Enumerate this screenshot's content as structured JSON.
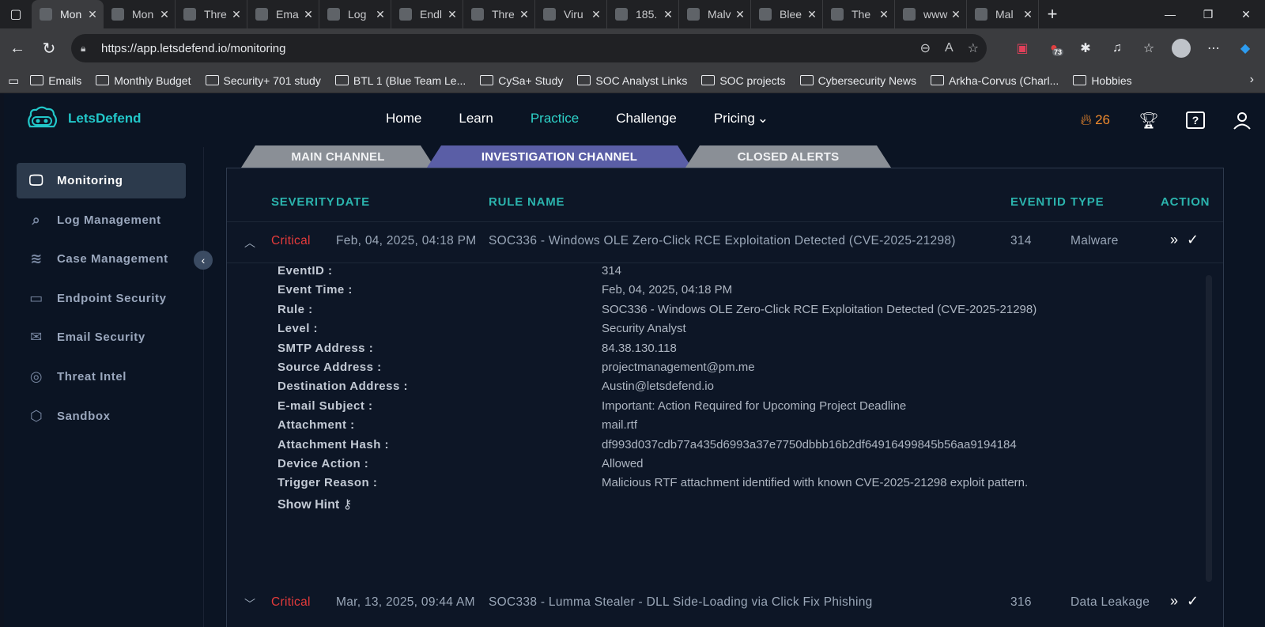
{
  "browser": {
    "tabs": [
      {
        "title": "Mon",
        "active": true
      },
      {
        "title": "Mon"
      },
      {
        "title": "Thre"
      },
      {
        "title": "Ema"
      },
      {
        "title": "Log"
      },
      {
        "title": "Endl"
      },
      {
        "title": "Thre"
      },
      {
        "title": "Viru"
      },
      {
        "title": "185."
      },
      {
        "title": "Malv"
      },
      {
        "title": "Blee"
      },
      {
        "title": "The"
      },
      {
        "title": "www"
      },
      {
        "title": "Mal"
      }
    ],
    "url": "https://app.letsdefend.io/monitoring",
    "extension_badge": "73",
    "bookmarks": [
      "Emails",
      "Monthly Budget",
      "Security+ 701 study",
      "BTL 1 (Blue Team Le...",
      "CySa+ Study",
      "SOC Analyst Links",
      "SOC projects",
      "Cybersecurity News",
      "Arkha-Corvus (Charl...",
      "Hobbies"
    ]
  },
  "app": {
    "brand": "LetsDefend",
    "menu": [
      "Home",
      "Learn",
      "Practice",
      "Challenge",
      "Pricing"
    ],
    "active_menu": "Practice",
    "streak": "26",
    "sidebar": [
      {
        "label": "Monitoring",
        "icon": "monitor-icon",
        "active": true
      },
      {
        "label": "Log Management",
        "icon": "search-icon"
      },
      {
        "label": "Case Management",
        "icon": "layers-icon"
      },
      {
        "label": "Endpoint Security",
        "icon": "drive-icon"
      },
      {
        "label": "Email Security",
        "icon": "mail-icon"
      },
      {
        "label": "Threat Intel",
        "icon": "lifebuoy-icon"
      },
      {
        "label": "Sandbox",
        "icon": "cube-icon"
      }
    ],
    "channel_tabs": [
      "MAIN CHANNEL",
      "INVESTIGATION CHANNEL",
      "CLOSED ALERTS"
    ],
    "active_channel": "INVESTIGATION CHANNEL",
    "table_headers": {
      "severity": "SEVERITY",
      "date": "DATE",
      "rule": "RULE NAME",
      "eventid": "EVENTID",
      "type": "TYPE",
      "action": "ACTION"
    },
    "alerts": [
      {
        "severity": "Critical",
        "date": "Feb, 04, 2025, 04:18 PM",
        "rule": "SOC336 - Windows OLE Zero-Click RCE Exploitation Detected (CVE-2025-21298)",
        "eventid": "314",
        "type": "Malware",
        "expanded": true
      },
      {
        "severity": "Critical",
        "date": "Mar, 13, 2025, 09:44 AM",
        "rule": "SOC338 - Lumma Stealer - DLL Side-Loading via Click Fix Phishing",
        "eventid": "316",
        "type": "Data Leakage",
        "expanded": false
      }
    ],
    "details": [
      {
        "label": "EventID :",
        "value": "314"
      },
      {
        "label": "Event Time :",
        "value": "Feb, 04, 2025, 04:18 PM"
      },
      {
        "label": "Rule :",
        "value": "SOC336 - Windows OLE Zero-Click RCE Exploitation Detected (CVE-2025-21298)"
      },
      {
        "label": "Level :",
        "value": "Security Analyst"
      },
      {
        "label": "SMTP Address :",
        "value": "84.38.130.118"
      },
      {
        "label": "Source Address :",
        "value": "projectmanagement@pm.me"
      },
      {
        "label": "Destination Address :",
        "value": "Austin@letsdefend.io"
      },
      {
        "label": "E-mail Subject :",
        "value": "Important: Action Required for Upcoming Project Deadline"
      },
      {
        "label": "Attachment :",
        "value": "mail.rtf"
      },
      {
        "label": "Attachment Hash :",
        "value": "df993d037cdb77a435d6993a37e7750dbbb16b2df64916499845b56aa9194184"
      },
      {
        "label": "Device Action :",
        "value": "Allowed"
      },
      {
        "label": "Trigger Reason :",
        "value": "Malicious RTF attachment identified with known CVE-2025-21298 exploit pattern."
      }
    ],
    "show_hint": "Show Hint"
  }
}
